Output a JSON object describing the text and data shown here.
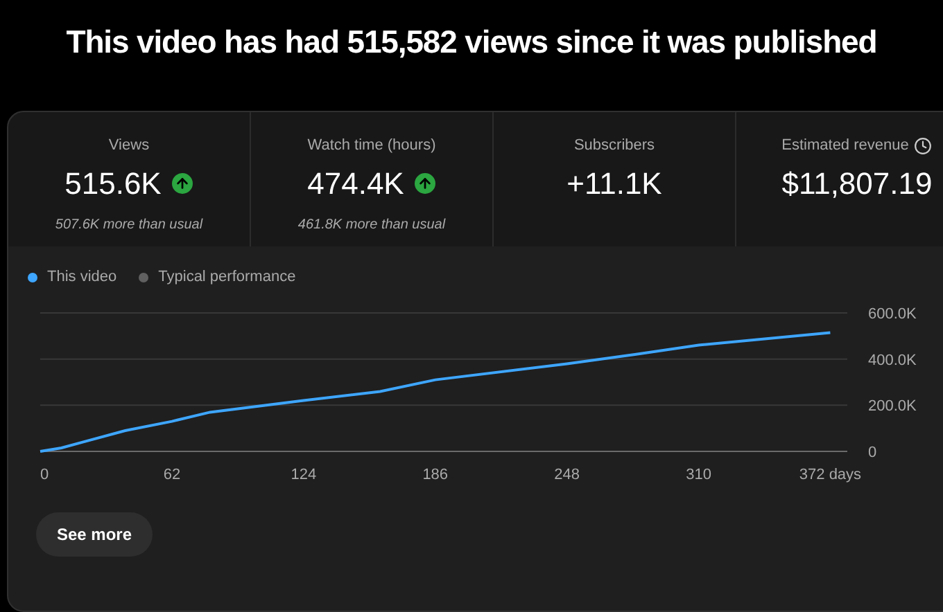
{
  "headline": "This video has had 515,582 views since it was published",
  "metrics": [
    {
      "label": "Views",
      "value": "515.6K",
      "trend_up": true,
      "note": "507.6K more than usual",
      "clock": false
    },
    {
      "label": "Watch time (hours)",
      "value": "474.4K",
      "trend_up": true,
      "note": "461.8K more than usual",
      "clock": false
    },
    {
      "label": "Subscribers",
      "value": "+11.1K",
      "trend_up": false,
      "clock": false
    },
    {
      "label": "Estimated revenue",
      "value": "$11,807.19",
      "trend_up": false,
      "clock": true
    }
  ],
  "legend": [
    {
      "label": "Typical performance",
      "color": "#606060"
    }
  ],
  "chart_data": {
    "type": "line",
    "x": [
      0,
      10,
      20,
      40,
      62,
      80,
      124,
      160,
      186,
      248,
      280,
      310,
      372
    ],
    "series": [
      {
        "name": "This video",
        "color": "#3ea6ff",
        "values": [
          0,
          15000,
          40000,
          90000,
          130000,
          170000,
          220000,
          260000,
          310000,
          380000,
          420000,
          460000,
          515000
        ]
      }
    ],
    "xticks": [
      0,
      62,
      124,
      186,
      248,
      310,
      {
        "value": 372,
        "label": "372 days"
      }
    ],
    "yticks": [
      0,
      {
        "value": 200000,
        "label": "200.0K"
      },
      {
        "value": 400000,
        "label": "400.0K"
      },
      {
        "value": 600000,
        "label": "600.0K"
      }
    ],
    "xlim": [
      0,
      380
    ],
    "ylim": [
      0,
      600000
    ]
  },
  "see_more": "See more"
}
